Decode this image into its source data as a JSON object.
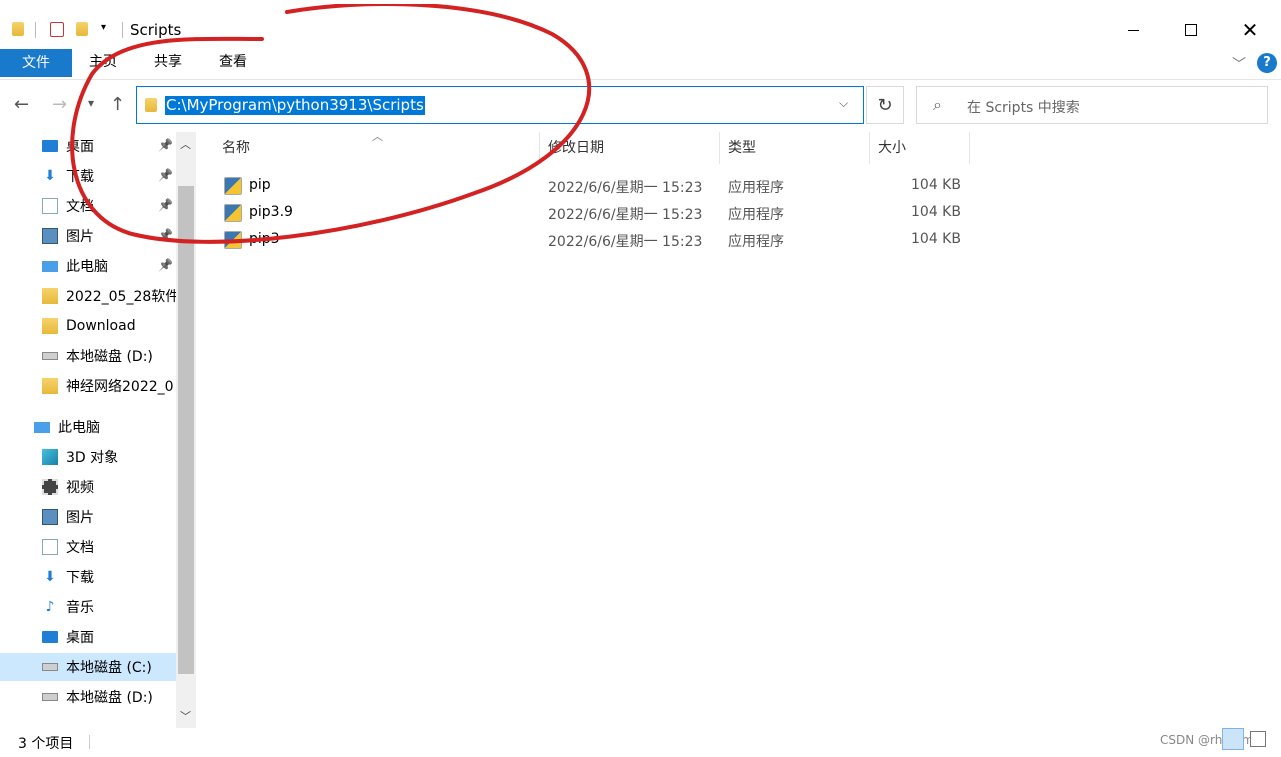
{
  "window": {
    "title": "Scripts"
  },
  "ribbon": {
    "tabs": [
      {
        "label": "文件"
      },
      {
        "label": "主页"
      },
      {
        "label": "共享"
      },
      {
        "label": "查看"
      }
    ]
  },
  "address": {
    "path": "C:\\MyProgram\\python3913\\Scripts"
  },
  "search": {
    "placeholder": "在 Scripts 中搜索"
  },
  "sidebar": {
    "quick_access": [
      {
        "label": "桌面",
        "icon": "desktop-icon",
        "pinned": true
      },
      {
        "label": "下载",
        "icon": "download-icon",
        "pinned": true
      },
      {
        "label": "文档",
        "icon": "document-icon",
        "pinned": true
      },
      {
        "label": "图片",
        "icon": "pictures-icon",
        "pinned": true
      },
      {
        "label": "此电脑",
        "icon": "computer-icon",
        "pinned": true
      },
      {
        "label": "2022_05_28软件",
        "icon": "folder-icon",
        "pinned": false
      },
      {
        "label": "Download",
        "icon": "folder-icon",
        "pinned": false
      },
      {
        "label": "本地磁盘 (D:)",
        "icon": "drive-icon",
        "pinned": false
      },
      {
        "label": "神经网络2022_0",
        "icon": "folder-icon",
        "pinned": false
      }
    ],
    "this_pc": {
      "label": "此电脑"
    },
    "this_pc_items": [
      {
        "label": "3D 对象",
        "icon": "3d-objects-icon"
      },
      {
        "label": "视频",
        "icon": "video-icon"
      },
      {
        "label": "图片",
        "icon": "pictures-icon"
      },
      {
        "label": "文档",
        "icon": "document-icon"
      },
      {
        "label": "下载",
        "icon": "download-icon"
      },
      {
        "label": "音乐",
        "icon": "music-icon"
      },
      {
        "label": "桌面",
        "icon": "desktop-icon"
      },
      {
        "label": "本地磁盘 (C:)",
        "icon": "drive-icon",
        "selected": true
      },
      {
        "label": "本地磁盘 (D:)",
        "icon": "drive-icon"
      }
    ]
  },
  "columns": [
    {
      "label": "名称"
    },
    {
      "label": "修改日期"
    },
    {
      "label": "类型"
    },
    {
      "label": "大小"
    }
  ],
  "files": [
    {
      "name": "pip",
      "date": "2022/6/6/星期一 15:23",
      "type": "应用程序",
      "size": "104 KB"
    },
    {
      "name": "pip3.9",
      "date": "2022/6/6/星期一 15:23",
      "type": "应用程序",
      "size": "104 KB"
    },
    {
      "name": "pip3",
      "date": "2022/6/6/星期一 15:23",
      "type": "应用程序",
      "size": "104 KB"
    }
  ],
  "status": {
    "count": "3 个项目"
  },
  "watermark": {
    "text": "CSDN @rhythm..."
  },
  "colors": {
    "accent": "#0078d7",
    "file_tab": "#1979ca",
    "annotation": "#d42121"
  }
}
